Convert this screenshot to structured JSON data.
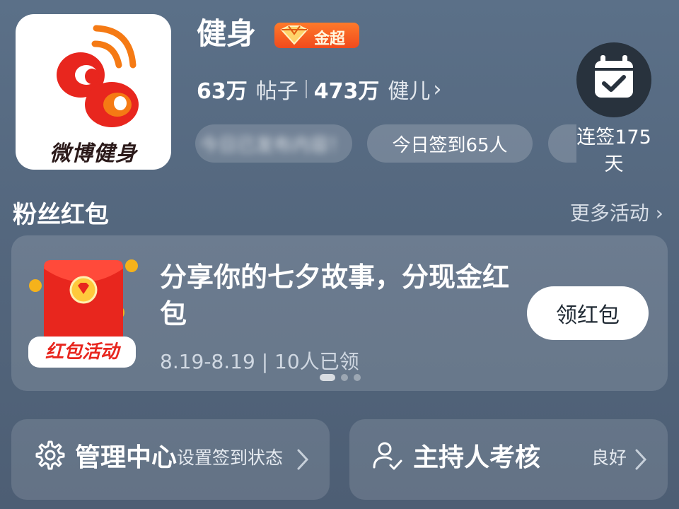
{
  "header": {
    "logo_text": "微博健身",
    "title": "健身",
    "badge_label": "金超",
    "badge_color": "#f25a22",
    "stats": {
      "posts_count": "63万",
      "posts_label": "帖子",
      "members_count": "473万",
      "members_label": "健儿",
      "chevron": "›"
    },
    "pills": {
      "checkin_today": "今日签到65人",
      "blurred": "今日已发布内容！"
    },
    "streak_line1": "连签175",
    "streak_line2": "天",
    "calendar_icon": "calendar-check-icon"
  },
  "section": {
    "title": "粉丝红包",
    "more_label": "更多活动 ›"
  },
  "redpacket": {
    "image_label": "红包活动",
    "title": "分享你的七夕故事，分现金红包",
    "meta": "8.19-8.19 | 10人已领",
    "button_label": "领红包",
    "carousel": {
      "count": 3,
      "active": 0
    }
  },
  "bottom": {
    "manage_label": "管理中心",
    "manage_sub": "设置签到状态",
    "host_label": "主持人考核",
    "host_status": "良好",
    "manage_icon": "gear-icon",
    "host_icon": "user-check-icon"
  },
  "colors": {
    "background": "#56697f",
    "accent_red": "#e8261e",
    "accent_orange": "#f57a14",
    "badge": "#f25a22"
  }
}
